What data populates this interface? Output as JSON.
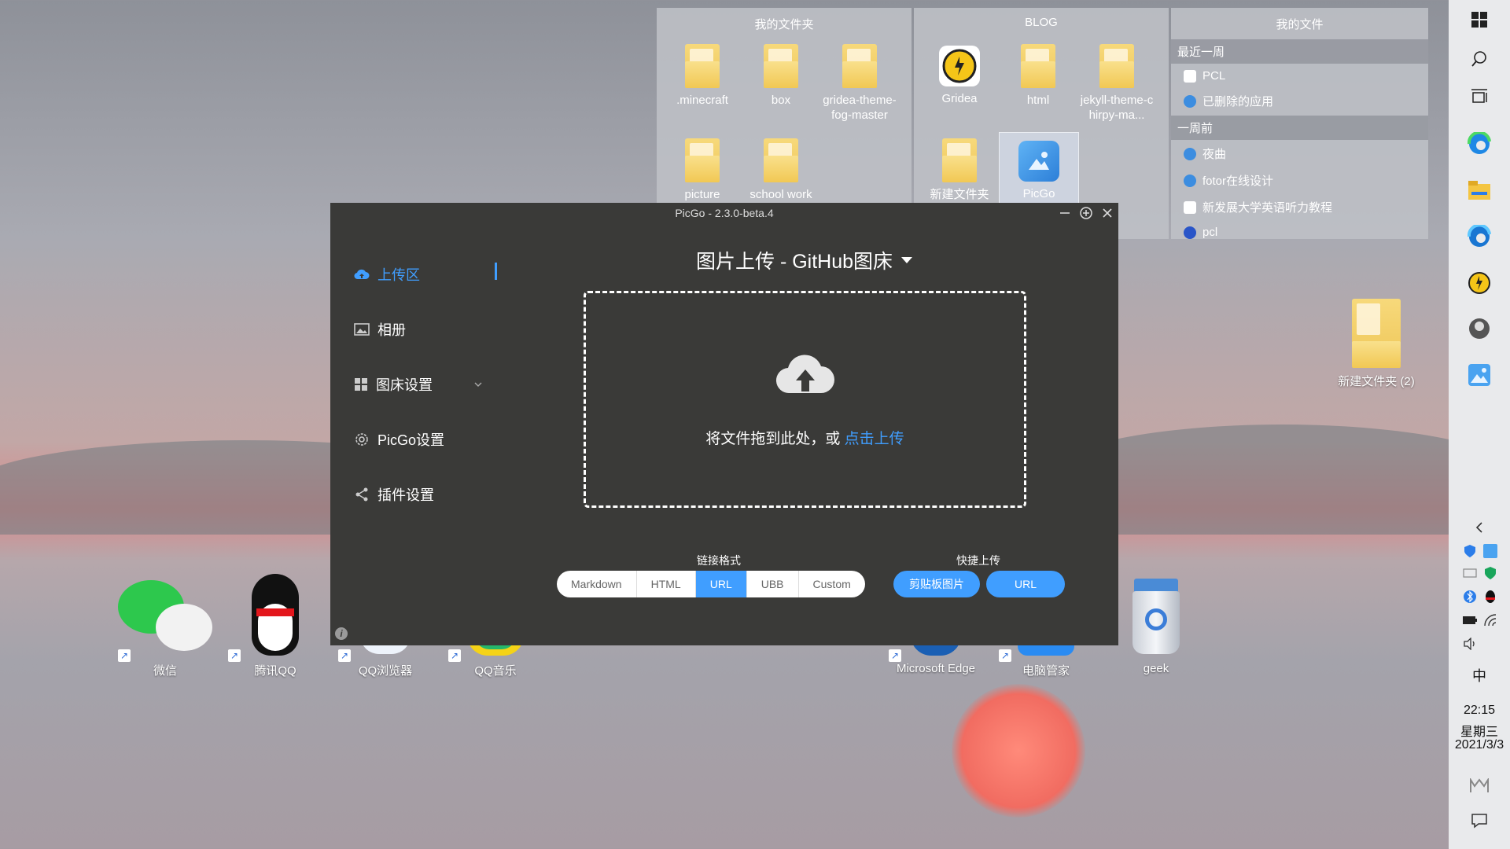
{
  "panels": {
    "my_folder": {
      "title": "我的文件夹",
      "items": [
        {
          "label": ".minecraft"
        },
        {
          "label": "box"
        },
        {
          "label": "gridea-theme-fog-master"
        },
        {
          "label": "picture"
        },
        {
          "label": "school work"
        }
      ]
    },
    "blog": {
      "title": "BLOG",
      "items": [
        {
          "label": "Gridea"
        },
        {
          "label": "html"
        },
        {
          "label": "jekyll-theme-chirpy-ma..."
        },
        {
          "label": "新建文件夹"
        },
        {
          "label": "PicGo"
        }
      ]
    },
    "my_files": {
      "title": "我的文件",
      "group1": "最近一周",
      "group1_items": [
        "PCL",
        "已删除的应用"
      ],
      "group2": "一周前",
      "group2_items": [
        "夜曲",
        "fotor在线设计",
        "新发展大学英语听力教程",
        "pcl"
      ]
    }
  },
  "desktop": {
    "right_folder": "新建文件夹 (2)",
    "icons": [
      "微信",
      "腾讯QQ",
      "QQ浏览器",
      "QQ音乐",
      "Microsoft Edge",
      "电脑管家",
      "geek"
    ]
  },
  "picgo": {
    "window_title": "PicGo - 2.3.0-beta.4",
    "nav": [
      "上传区",
      "相册",
      "图床设置",
      "PicGo设置",
      "插件设置"
    ],
    "heading": "图片上传 - GitHub图床",
    "drop_text": "将文件拖到此处，或",
    "drop_link": "点击上传",
    "link_format_label": "链接格式",
    "formats": [
      "Markdown",
      "HTML",
      "URL",
      "UBB",
      "Custom"
    ],
    "selected_format": "URL",
    "quick_upload_label": "快捷上传",
    "quick_buttons": [
      "剪贴板图片",
      "URL"
    ],
    "accent": "#409eff"
  },
  "taskbar": {
    "ime": "中",
    "time": "22:15",
    "weekday": "星期三",
    "date": "2021/3/3"
  }
}
